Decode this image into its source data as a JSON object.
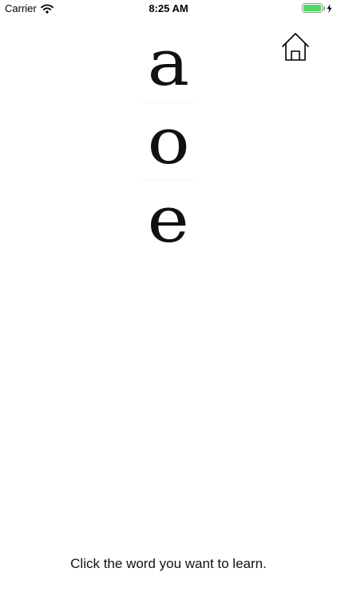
{
  "status_bar": {
    "carrier": "Carrier",
    "time": "8:25 AM",
    "battery_level": 1.0,
    "battery_color": "#4cd964",
    "icons": [
      "wifi-icon",
      "battery-icon",
      "charging-bolt-icon"
    ]
  },
  "header": {
    "home_icon": "home-icon"
  },
  "letters": [
    {
      "text": "a"
    },
    {
      "text": "o"
    },
    {
      "text": "e"
    }
  ],
  "footer": {
    "instruction": "Click the word you want to learn."
  }
}
